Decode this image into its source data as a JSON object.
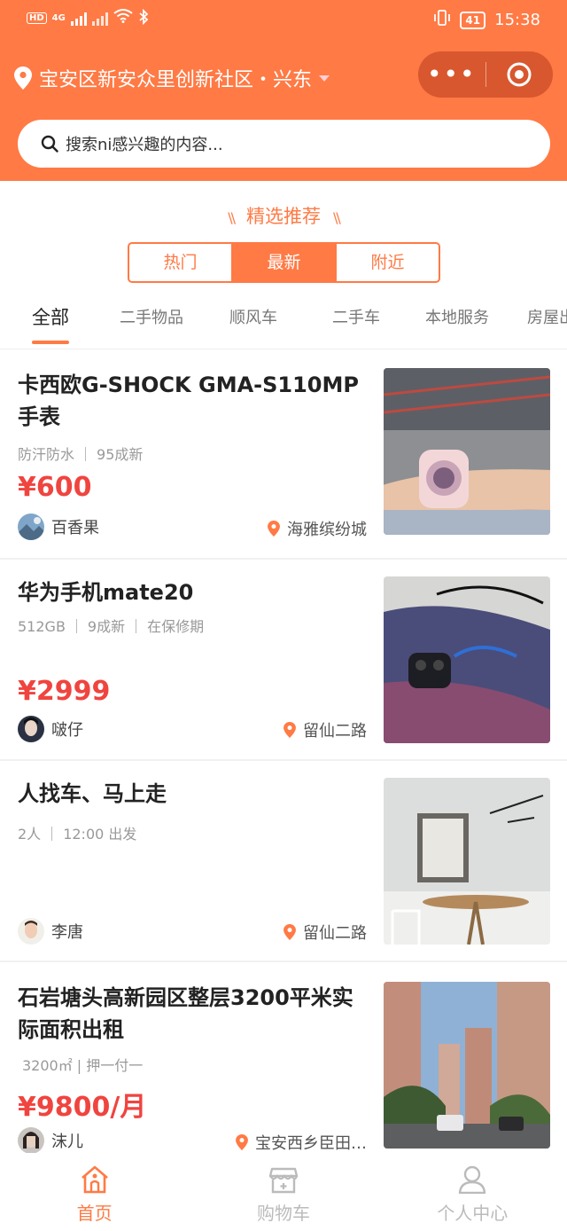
{
  "status_bar": {
    "network_label": "HD",
    "network_type": "4G",
    "battery": "41",
    "time": "15:38"
  },
  "header": {
    "location": "宝安区新安众里创新社区・兴东",
    "search_placeholder": "搜索ni感兴趣的内容..."
  },
  "section": {
    "title": "精选推荐",
    "segments": [
      "热门",
      "最新",
      "附近"
    ],
    "active_segment": "最新"
  },
  "categories": [
    "全部",
    "二手物品",
    "顺风车",
    "二手车",
    "本地服务",
    "房屋出"
  ],
  "active_category": "全部",
  "listings": [
    {
      "title": "卡西欧G-SHOCK GMA-S110MP手表",
      "tags": [
        "防汗防水",
        "95成新"
      ],
      "price": "¥600",
      "user": "百香果",
      "place": "海雅缤纷城"
    },
    {
      "title": "华为手机mate20",
      "tags": [
        "512GB",
        "9成新",
        "在保修期"
      ],
      "price": "¥2999",
      "user": "啵仔",
      "place": "留仙二路"
    },
    {
      "title": "人找车、马上走",
      "tags": [
        "2人",
        "12:00 出发"
      ],
      "price": "",
      "user": "李唐",
      "place": "留仙二路"
    },
    {
      "title": "石岩塘头高新园区整层3200平米实际面积出租",
      "tags": [
        "3200㎡ | 押一付一"
      ],
      "price": "¥9800/月",
      "user": "沫儿",
      "place": "宝安西乡臣田…"
    }
  ],
  "tabbar": {
    "items": [
      "首页",
      "购物车",
      "个人中心"
    ],
    "active": "首页"
  },
  "colors": {
    "accent": "#ff7a45",
    "price": "#f0443f"
  }
}
